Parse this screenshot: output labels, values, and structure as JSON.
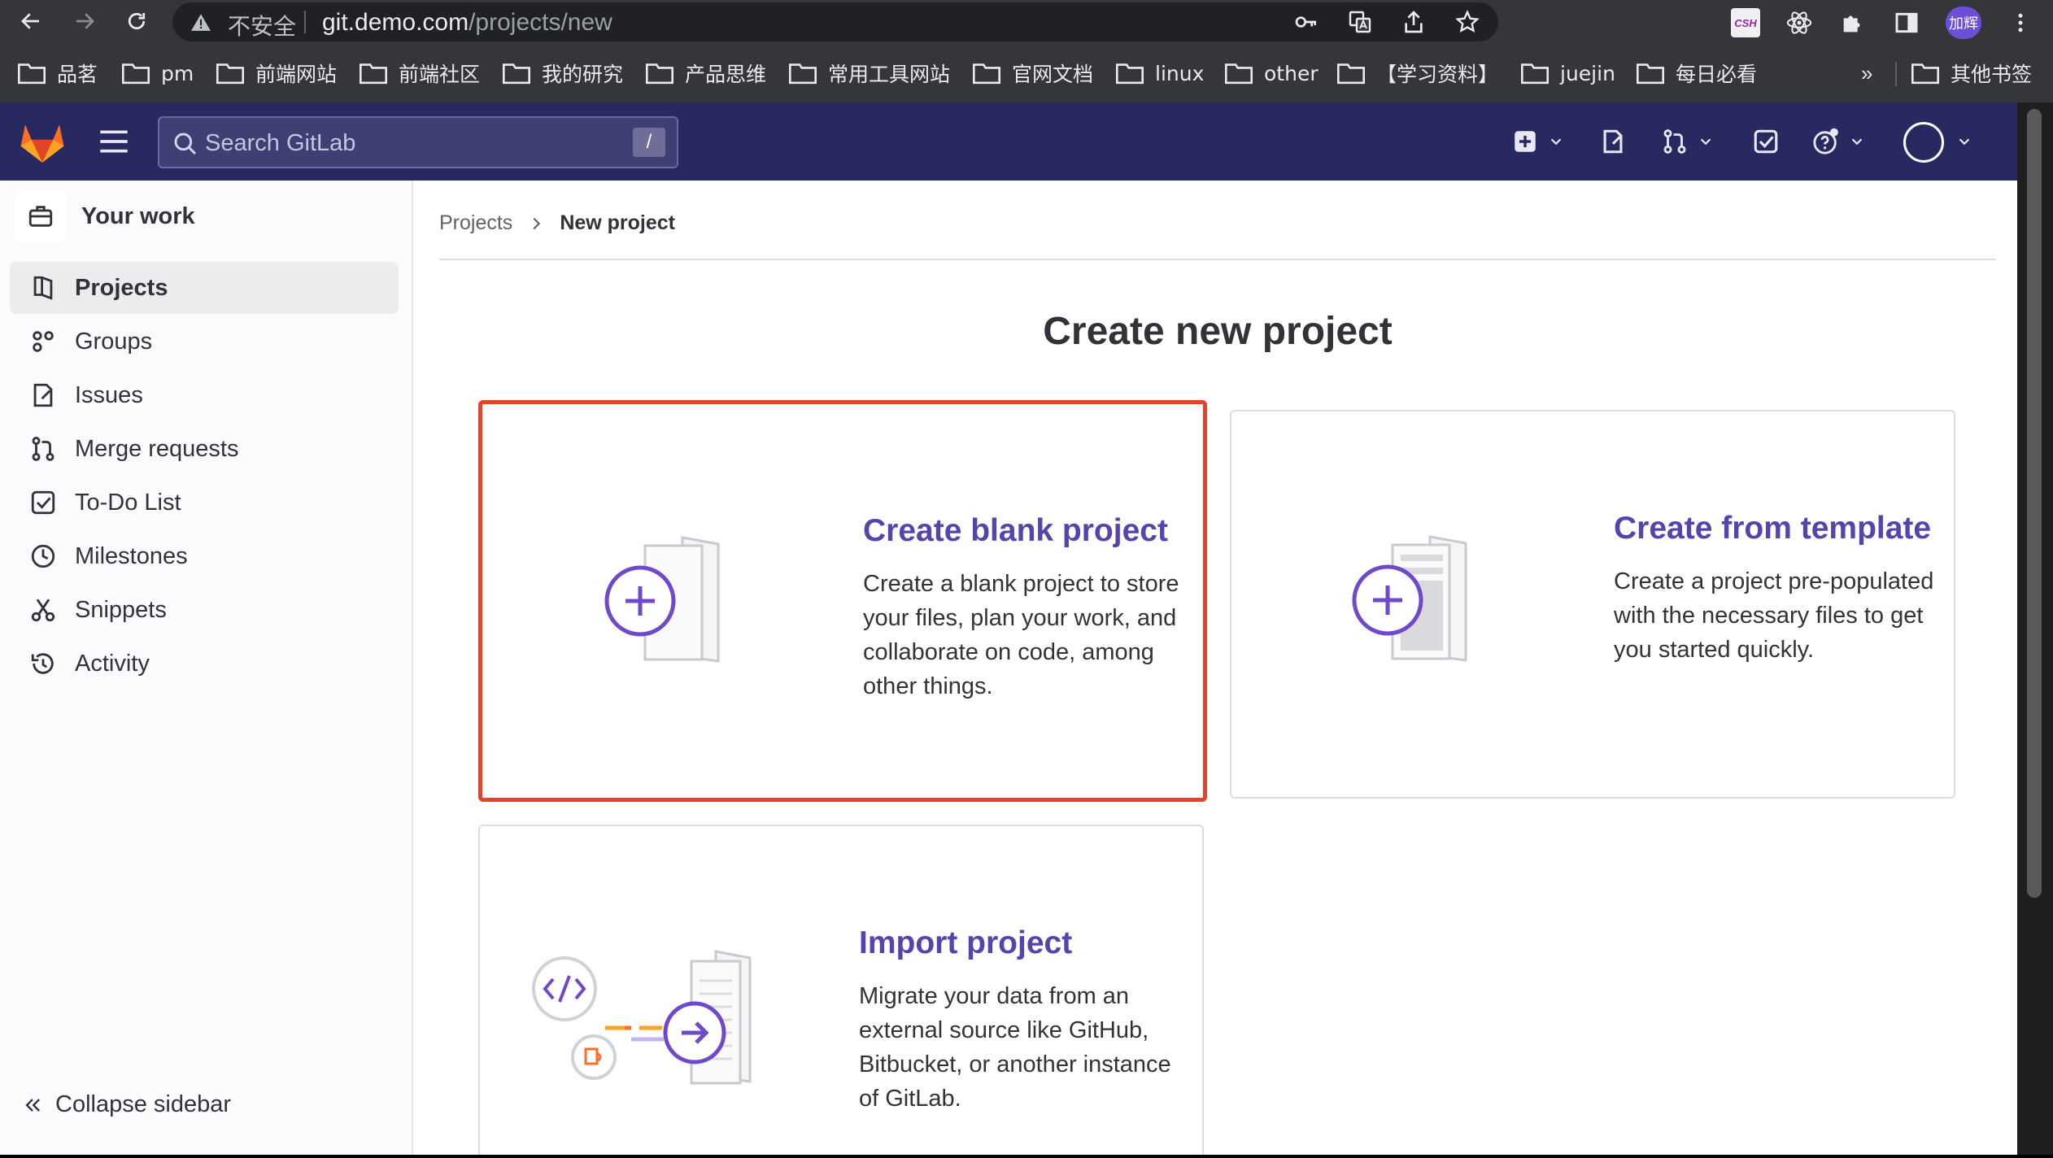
{
  "browser": {
    "security_label": "不安全",
    "url_host": "git.demo.com",
    "url_path": "/projects/new",
    "profile_label": "加辉",
    "ext_csh_label": "CSH",
    "bookmarks": [
      "品茗",
      "pm",
      "前端网站",
      "前端社区",
      "我的研究",
      "产品思维",
      "常用工具网站",
      "官网文档",
      "linux",
      "other",
      "【学习资料】",
      "juejin",
      "每日必看"
    ],
    "bookmarks_more": "»",
    "other_bookmarks": "其他书签"
  },
  "topbar": {
    "search_placeholder": "Search GitLab",
    "search_shortcut": "/"
  },
  "sidebar": {
    "context_title": "Your work",
    "items": [
      {
        "label": "Projects",
        "icon": "project-icon",
        "active": true
      },
      {
        "label": "Groups",
        "icon": "group-icon"
      },
      {
        "label": "Issues",
        "icon": "issues-icon"
      },
      {
        "label": "Merge requests",
        "icon": "merge-request-icon"
      },
      {
        "label": "To-Do List",
        "icon": "todo-icon"
      },
      {
        "label": "Milestones",
        "icon": "milestone-icon"
      },
      {
        "label": "Snippets",
        "icon": "snippet-icon"
      },
      {
        "label": "Activity",
        "icon": "history-icon"
      }
    ],
    "collapse_label": "Collapse sidebar"
  },
  "breadcrumb": {
    "parent": "Projects",
    "current": "New project"
  },
  "main": {
    "title": "Create new project",
    "cards": [
      {
        "title": "Create blank project",
        "description": "Create a blank project to store your files, plan your work, and collaborate on code, among other things."
      },
      {
        "title": "Create from template",
        "description": "Create a project pre-populated with the necessary files to get you started quickly."
      },
      {
        "title": "Import project",
        "description": "Migrate your data from an external source like GitHub, Bitbucket, or another instance of GitLab."
      }
    ]
  },
  "colors": {
    "topbar_bg": "#292961",
    "accent_purple": "#5643ad",
    "selection_red": "#e24329"
  }
}
